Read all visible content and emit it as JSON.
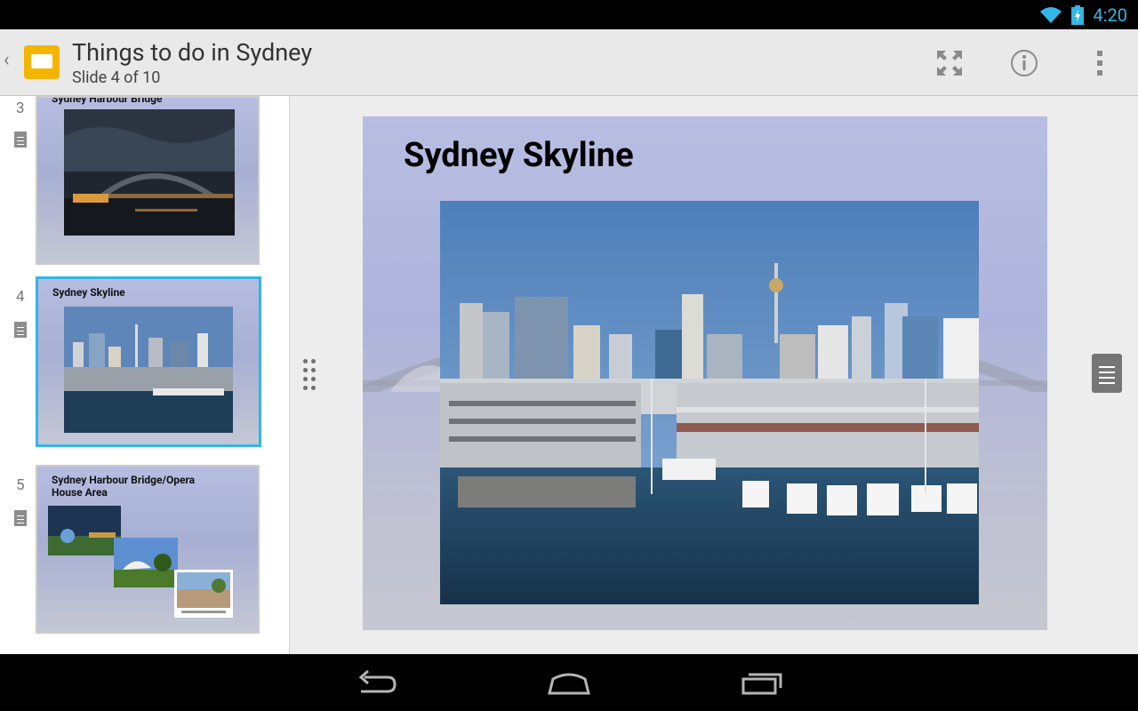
{
  "status": {
    "time": "4:20"
  },
  "header": {
    "title": "Things to do in Sydney",
    "subtitle": "Slide 4 of 10"
  },
  "sidebar": {
    "slides": [
      {
        "number": "3",
        "title": "Sydney Harbour Bridge"
      },
      {
        "number": "4",
        "title": "Sydney Skyline"
      },
      {
        "number": "5",
        "title": "Sydney Harbour Bridge/Opera House Area"
      }
    ]
  },
  "slide": {
    "title": "Sydney Skyline"
  },
  "colors": {
    "accent": "#33b5e5",
    "app_icon": "#f4b400"
  }
}
